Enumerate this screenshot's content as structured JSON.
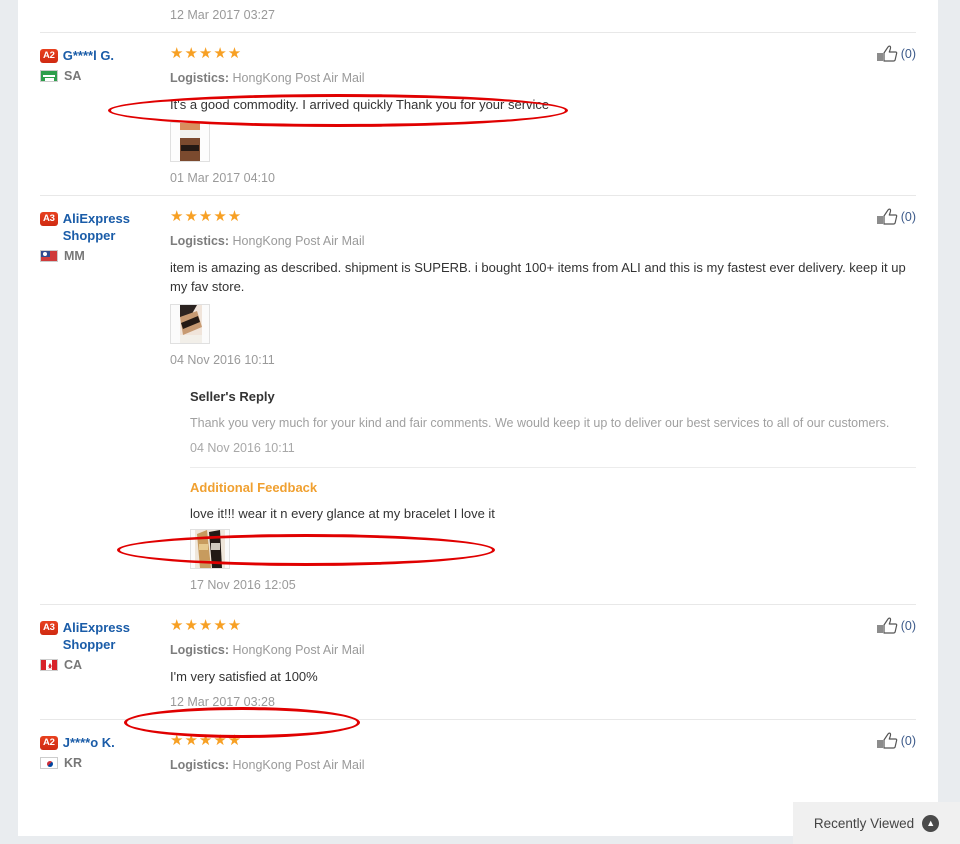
{
  "page": {
    "top_partial_date": "12 Mar 2017 03:27",
    "logistics_label": "Logistics:",
    "stars": "★★★★★",
    "like_icon": "thumbs-up-icon"
  },
  "reviews": [
    {
      "level_badge": "A2",
      "name": "G****l G.",
      "country_code": "SA",
      "flag": "flag-sa",
      "stars": "★★★★★",
      "logistics_label": "Logistics:",
      "logistics_value": "HongKong Post Air Mail",
      "text": "It's a good commodity. I arrived quickly Thank you for your service",
      "date": "01 Mar 2017 04:10",
      "like_count": "(0)",
      "has_photo": true
    },
    {
      "level_badge": "A3",
      "name": "AliExpress Shopper",
      "country_code": "MM",
      "flag": "flag-mm",
      "stars": "★★★★★",
      "logistics_label": "Logistics:",
      "logistics_value": "HongKong Post Air Mail",
      "text": "item is amazing as described. shipment is SUPERB. i bought 100+ items from ALI and this is my fastest ever delivery. keep it up my fav store.",
      "date": "04 Nov 2016 10:11",
      "like_count": "(0)",
      "has_photo": true,
      "seller_reply": {
        "title": "Seller's Reply",
        "text": "Thank you very much for your kind and fair comments. We would keep it up to deliver our best services to all of our customers.",
        "date": "04 Nov 2016 10:11"
      },
      "additional_feedback": {
        "title": "Additional Feedback",
        "text": "love it!!! wear it n every glance at my bracelet I love it",
        "date": "17 Nov 2016 12:05"
      }
    },
    {
      "level_badge": "A3",
      "name": "AliExpress Shopper",
      "country_code": "CA",
      "flag": "flag-ca",
      "stars": "★★★★★",
      "logistics_label": "Logistics:",
      "logistics_value": "HongKong Post Air Mail",
      "text": "I'm very satisfied at 100%",
      "date": "12 Mar 2017 03:28",
      "like_count": "(0)",
      "has_photo": false
    },
    {
      "level_badge": "A2",
      "name": "J****o K.",
      "country_code": "KR",
      "flag": "flag-kr",
      "stars": "★★★★★",
      "logistics_label": "Logistics:",
      "logistics_value": "HongKong Post Air Mail",
      "text": "",
      "date": "",
      "like_count": "(0)",
      "has_photo": false
    }
  ],
  "recently_viewed": {
    "label": "Recently Viewed",
    "arrow_icon": "chevron-up-circle-icon",
    "arrow_glyph": "▲"
  },
  "annotations": {
    "highlight_color": "#e00000",
    "count": 3
  }
}
